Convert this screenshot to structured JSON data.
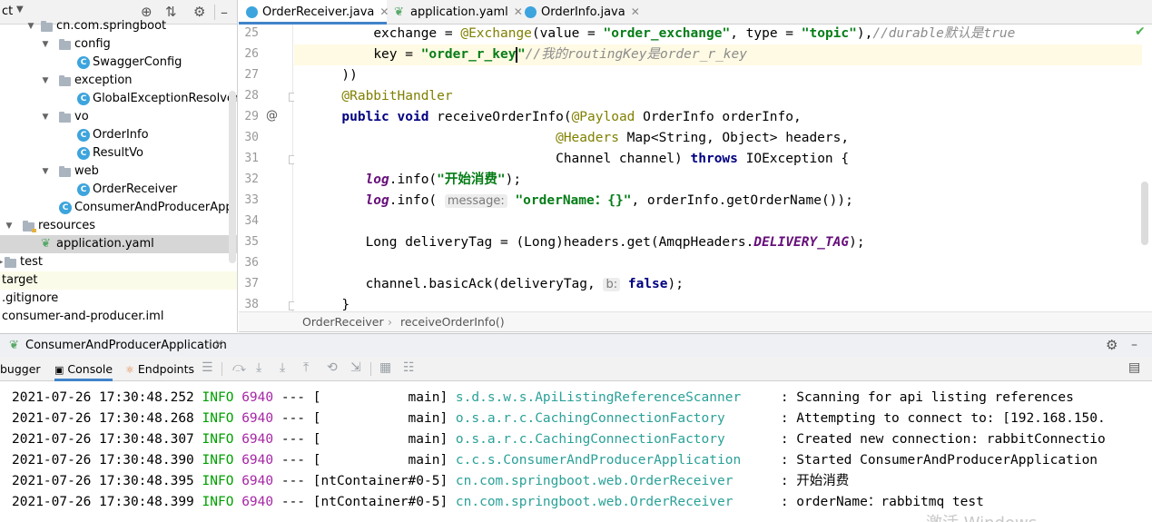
{
  "tree": {
    "toolbar_label": "ct",
    "rows": [
      {
        "label": "cn.com.springboot",
        "kind": "folder"
      },
      {
        "label": "config",
        "kind": "folder"
      },
      {
        "label": "SwaggerConfig",
        "kind": "class"
      },
      {
        "label": "exception",
        "kind": "folder"
      },
      {
        "label": "GlobalExceptionResolver",
        "kind": "class"
      },
      {
        "label": "vo",
        "kind": "folder"
      },
      {
        "label": "OrderInfo",
        "kind": "class"
      },
      {
        "label": "ResultVo",
        "kind": "class"
      },
      {
        "label": "web",
        "kind": "folder"
      },
      {
        "label": "OrderReceiver",
        "kind": "class"
      },
      {
        "label": "ConsumerAndProducerApplica",
        "kind": "class"
      },
      {
        "label": "resources",
        "kind": "folder"
      },
      {
        "label": "application.yaml",
        "kind": "yaml",
        "selected": true
      },
      {
        "label": "test",
        "kind": "folder"
      },
      {
        "label": "target",
        "kind": "folder"
      },
      {
        "label": ".gitignore",
        "kind": "file"
      },
      {
        "label": "consumer-and-producer.iml",
        "kind": "file"
      }
    ]
  },
  "tabs": [
    {
      "label": "OrderReceiver.java",
      "active": true
    },
    {
      "label": "application.yaml",
      "active": false
    },
    {
      "label": "OrderInfo.java",
      "active": false
    }
  ],
  "editor": {
    "line_numbers": [
      "25",
      "26",
      "27",
      "28",
      "29",
      "30",
      "31",
      "32",
      "33",
      "34",
      "35",
      "36",
      "37",
      "38"
    ],
    "l25": {
      "indent": "          ",
      "a": "exchange = ",
      "ann": "@Exchange",
      "b": "(value = ",
      "s1": "\"order_exchange\"",
      "c": ", type = ",
      "s2": "\"topic\"",
      "d": "),",
      "cmt": "//durable默认是true"
    },
    "l26": {
      "indent": "          ",
      "a": "key = ",
      "s1": "\"order_r_key",
      "s2": "\"",
      "cmt": "//我的routingKey是order_r_key"
    },
    "l27": "      ))",
    "l28": {
      "indent": "      ",
      "ann": "@RabbitHandler"
    },
    "l29": {
      "indent": "      ",
      "kw1": "public void ",
      "a": "receiveOrderInfo(",
      "ann": "@Payload",
      "b": " OrderInfo orderInfo,"
    },
    "l30": {
      "indent": "                                 ",
      "ann": "@Headers",
      "b": " Map<String, Object> headers,"
    },
    "l31": {
      "indent": "                                 ",
      "a": "Channel channel) ",
      "kw": "throws",
      "b": " IOException {"
    },
    "l32": {
      "indent": "         ",
      "fld": "log",
      "a": ".info(",
      "s": "\"开始消费\"",
      "b": ");"
    },
    "l33": {
      "indent": "         ",
      "fld": "log",
      "a": ".info( ",
      "hint": "message:",
      "s": "\"orderName：{}\"",
      "b": ", orderInfo.getOrderName());"
    },
    "l35": {
      "indent": "         ",
      "a": "Long deliveryTag = (Long)headers.get(AmqpHeaders.",
      "fld": "DELIVERY_TAG",
      "b": ");"
    },
    "l37": {
      "indent": "         ",
      "a": "channel.basicAck(deliveryTag, ",
      "hint": "b:",
      "kw": "false",
      "b": ");"
    },
    "l38": "      }"
  },
  "breadcrumb": {
    "item1": "OrderReceiver",
    "sep": "›",
    "item2": "receiveOrderInfo()"
  },
  "run": {
    "title": "ConsumerAndProducerApplication",
    "tabs": {
      "debugger": "bugger",
      "console": "Console",
      "endpoints": "Endpoints"
    },
    "logs": [
      {
        "ts": "2021-07-26 17:30:48.252",
        "level": "INFO",
        "pid": "6940",
        "dashes": " --- ",
        "thread": "[           main]",
        "logger": "s.d.s.w.s.ApiListingReferenceScanner",
        "msg": "     : Scanning for api listing references"
      },
      {
        "ts": "2021-07-26 17:30:48.268",
        "level": "INFO",
        "pid": "6940",
        "dashes": " --- ",
        "thread": "[           main]",
        "logger": "o.s.a.r.c.CachingConnectionFactory",
        "msg": "       : Attempting to connect to: [192.168.150."
      },
      {
        "ts": "2021-07-26 17:30:48.307",
        "level": "INFO",
        "pid": "6940",
        "dashes": " --- ",
        "thread": "[           main]",
        "logger": "o.s.a.r.c.CachingConnectionFactory",
        "msg": "       : Created new connection: rabbitConnectio"
      },
      {
        "ts": "2021-07-26 17:30:48.390",
        "level": "INFO",
        "pid": "6940",
        "dashes": " --- ",
        "thread": "[           main]",
        "logger": "c.c.s.ConsumerAndProducerApplication",
        "msg": "     : Started ConsumerAndProducerApplication"
      },
      {
        "ts": "2021-07-26 17:30:48.395",
        "level": "INFO",
        "pid": "6940",
        "dashes": " --- ",
        "thread": "[ntContainer#0-5]",
        "logger": "cn.com.springboot.web.OrderReceiver",
        "msg": "      : 开始消费"
      },
      {
        "ts": "2021-07-26 17:30:48.399",
        "level": "INFO",
        "pid": "6940",
        "dashes": " --- ",
        "thread": "[ntContainer#0-5]",
        "logger": "cn.com.springboot.web.OrderReceiver",
        "msg": "      : orderName：rabbitmq test"
      }
    ]
  },
  "watermark": "激活 Windows",
  "colors": {
    "accent": "#4083c9",
    "string": "#067d17",
    "keyword": "#000080",
    "annotation": "#808000",
    "log_level": "#00a000",
    "pid": "#a626a4",
    "logger": "#2aa198"
  }
}
